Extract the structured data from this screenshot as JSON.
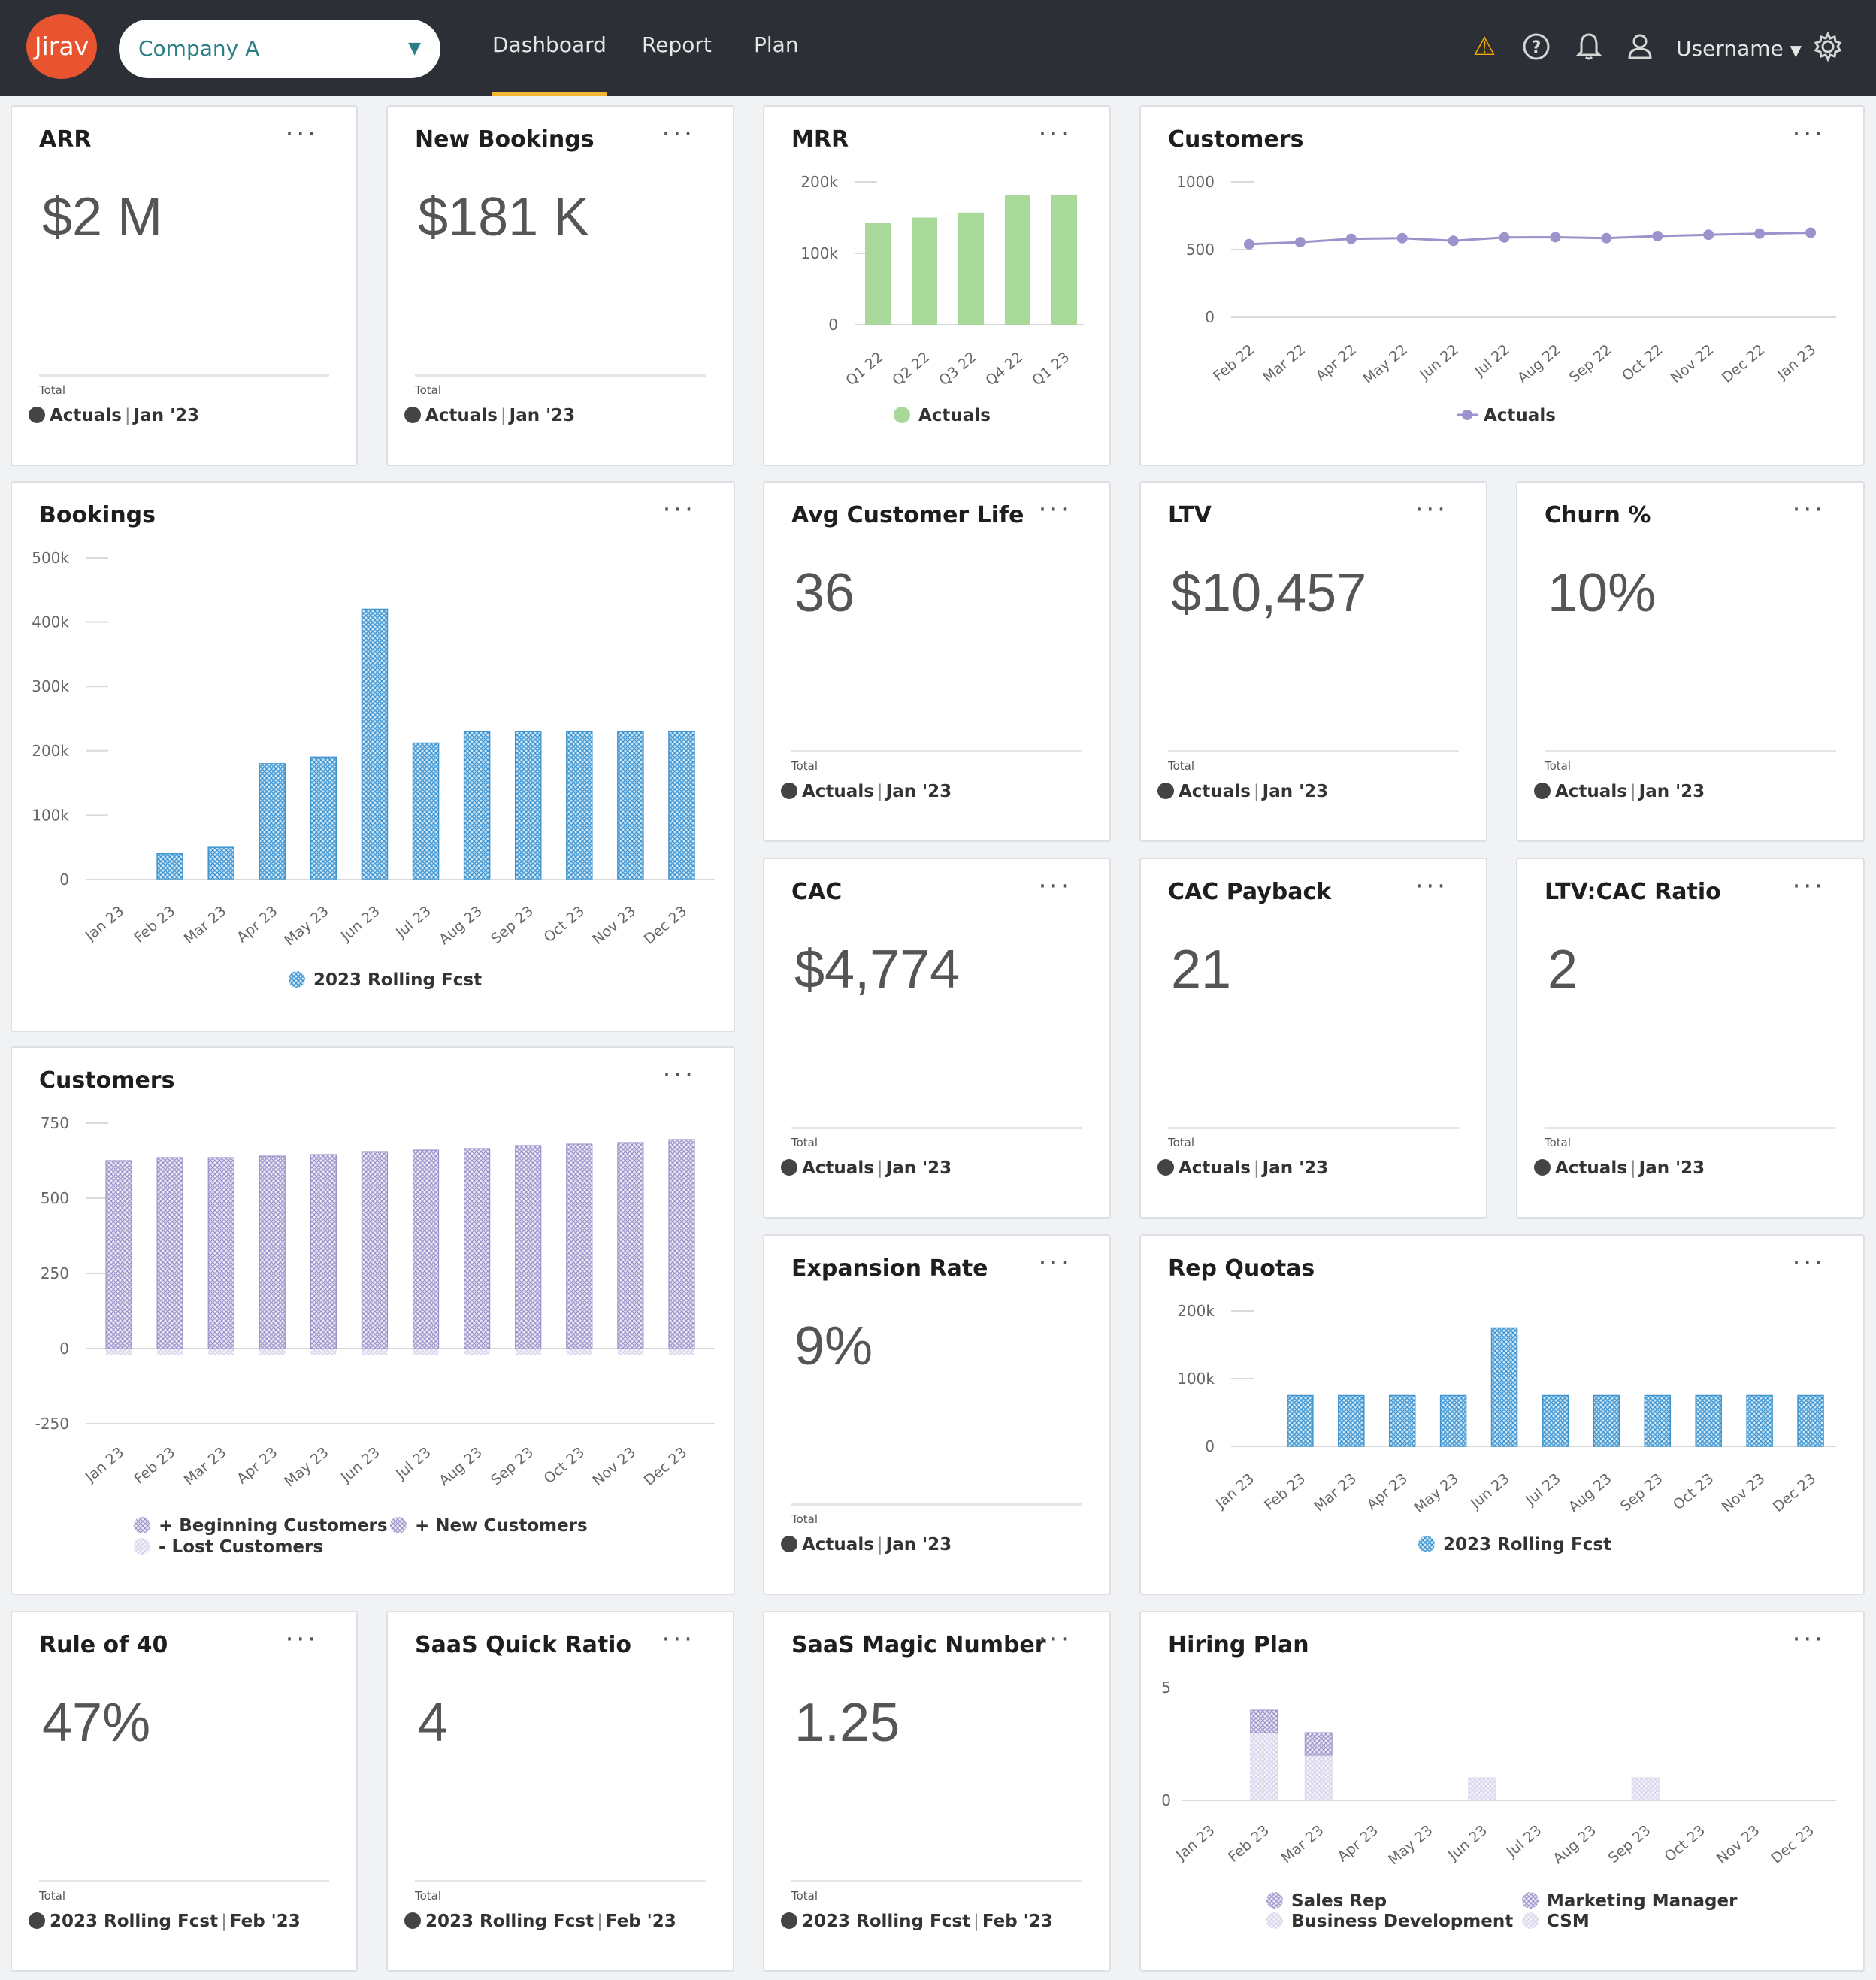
{
  "app": {
    "logo_text": "Jirav"
  },
  "topnav": {
    "company": "Company A",
    "links": [
      "Dashboard",
      "Report",
      "Plan"
    ],
    "icons": [
      "warning-icon",
      "help-icon",
      "bell-icon",
      "user-icon",
      "gear-icon"
    ],
    "username": "Username"
  },
  "cards": {
    "arr": {
      "title": "ARR",
      "value": "$2 M",
      "total": "Total",
      "series": "Actuals",
      "period": "Jan '23"
    },
    "new_bookings": {
      "title": "New Bookings",
      "value": "$181 K",
      "total": "Total",
      "series": "Actuals",
      "period": "Jan '23"
    },
    "avg_life": {
      "title": "Avg Customer Life",
      "value": "36",
      "total": "Total",
      "series": "Actuals",
      "period": "Jan '23"
    },
    "ltv": {
      "title": "LTV",
      "value": "$10,457",
      "total": "Total",
      "series": "Actuals",
      "period": "Jan '23"
    },
    "churn": {
      "title": "Churn %",
      "value": "10%",
      "total": "Total",
      "series": "Actuals",
      "period": "Jan '23"
    },
    "cac": {
      "title": "CAC",
      "value": "$4,774",
      "total": "Total",
      "series": "Actuals",
      "period": "Jan '23"
    },
    "cac_payback": {
      "title": "CAC Payback",
      "value": "21",
      "total": "Total",
      "series": "Actuals",
      "period": "Jan '23"
    },
    "ltv_cac": {
      "title": "LTV:CAC Ratio",
      "value": "2",
      "total": "Total",
      "series": "Actuals",
      "period": "Jan '23"
    },
    "expansion": {
      "title": "Expansion Rate",
      "value": "9%",
      "total": "Total",
      "series": "Actuals",
      "period": "Jan '23"
    },
    "rule40": {
      "title": "Rule of 40",
      "value": "47%",
      "total": "Total",
      "series": "2023 Rolling Fcst",
      "period": "Feb '23"
    },
    "quick_ratio": {
      "title": "SaaS Quick Ratio",
      "value": "4",
      "total": "Total",
      "series": "2023 Rolling Fcst",
      "period": "Feb '23"
    },
    "magic": {
      "title": "SaaS Magic Number",
      "value": "1.25",
      "total": "Total",
      "series": "2023 Rolling Fcst",
      "period": "Feb '23"
    },
    "mrr": {
      "title": "MRR"
    },
    "customers_line": {
      "title": "Customers"
    },
    "bookings": {
      "title": "Bookings"
    },
    "customers_bar": {
      "title": "Customers"
    },
    "rep_quotas": {
      "title": "Rep Quotas"
    },
    "hiring": {
      "title": "Hiring Plan"
    }
  },
  "colors": {
    "green": "#a8d99b",
    "blue": "#4a9ed6",
    "purple": "#a59ad0",
    "purple_light": "#e4e0f3",
    "accent": "#f2b632"
  },
  "chart_data": [
    {
      "id": "mrr",
      "type": "bar",
      "categories": [
        "Q1 22",
        "Q2 22",
        "Q3 22",
        "Q4 22",
        "Q1 23"
      ],
      "values": [
        143000,
        150000,
        157000,
        181000,
        182000
      ],
      "yticks": [
        "0",
        "100k",
        "200k"
      ],
      "ylim": [
        0,
        200000
      ],
      "legend": [
        "Actuals"
      ]
    },
    {
      "id": "customers_line",
      "type": "line",
      "categories": [
        "Feb 22",
        "Mar 22",
        "Apr 22",
        "May 22",
        "Jun 22",
        "Jul 22",
        "Aug 22",
        "Sep 22",
        "Oct 22",
        "Nov 22",
        "Dec 22",
        "Jan 23"
      ],
      "values": [
        540,
        555,
        580,
        585,
        565,
        590,
        592,
        585,
        600,
        610,
        618,
        625
      ],
      "yticks": [
        "0",
        "500",
        "1000"
      ],
      "ylim": [
        0,
        1000
      ],
      "legend": [
        "Actuals"
      ]
    },
    {
      "id": "bookings",
      "type": "bar",
      "categories": [
        "Jan 23",
        "Feb 23",
        "Mar 23",
        "Apr 23",
        "May 23",
        "Jun 23",
        "Jul 23",
        "Aug 23",
        "Sep 23",
        "Oct 23",
        "Nov 23",
        "Dec 23"
      ],
      "values": [
        0,
        40000,
        50000,
        180000,
        190000,
        420000,
        212000,
        230000,
        230000,
        230000,
        230000,
        230000
      ],
      "yticks": [
        "0",
        "100k",
        "200k",
        "300k",
        "400k",
        "500k"
      ],
      "ylim": [
        0,
        500000
      ],
      "legend": [
        "2023 Rolling Fcst"
      ]
    },
    {
      "id": "customers_bar",
      "type": "bar",
      "categories": [
        "Jan 23",
        "Feb 23",
        "Mar 23",
        "Apr 23",
        "May 23",
        "Jun 23",
        "Jul 23",
        "Aug 23",
        "Sep 23",
        "Oct 23",
        "Nov 23",
        "Dec 23"
      ],
      "series": [
        {
          "name": "+ Beginning Customers",
          "values": [
            625,
            635,
            635,
            640,
            645,
            655,
            660,
            665,
            675,
            680,
            685,
            695
          ]
        },
        {
          "name": "+ New Customers",
          "values": [
            0,
            0,
            0,
            0,
            0,
            0,
            0,
            0,
            0,
            0,
            0,
            0
          ]
        },
        {
          "name": "- Lost Customers",
          "values": [
            -20,
            -20,
            -20,
            -20,
            -20,
            -20,
            -20,
            -20,
            -20,
            -20,
            -20,
            -20
          ]
        }
      ],
      "yticks": [
        "-250",
        "0",
        "250",
        "500",
        "750"
      ],
      "ylim": [
        -250,
        750
      ]
    },
    {
      "id": "rep_quotas",
      "type": "bar",
      "categories": [
        "Jan 23",
        "Feb 23",
        "Mar 23",
        "Apr 23",
        "May 23",
        "Jun 23",
        "Jul 23",
        "Aug 23",
        "Sep 23",
        "Oct 23",
        "Nov 23",
        "Dec 23"
      ],
      "values": [
        0,
        75000,
        75000,
        75000,
        75000,
        175000,
        75000,
        75000,
        75000,
        75000,
        75000,
        75000
      ],
      "yticks": [
        "0",
        "100k",
        "200k"
      ],
      "ylim": [
        0,
        200000
      ],
      "legend": [
        "2023 Rolling Fcst"
      ]
    },
    {
      "id": "hiring",
      "type": "bar",
      "categories": [
        "Jan 23",
        "Feb 23",
        "Mar 23",
        "Apr 23",
        "May 23",
        "Jun 23",
        "Jul 23",
        "Aug 23",
        "Sep 23",
        "Oct 23",
        "Nov 23",
        "Dec 23"
      ],
      "series": [
        {
          "name": "Sales Rep",
          "values": [
            0,
            1,
            1,
            0,
            0,
            0,
            0,
            0,
            0,
            0,
            0,
            0
          ]
        },
        {
          "name": "Marketing Manager",
          "values": [
            0,
            0,
            0,
            0,
            0,
            0,
            0,
            0,
            0,
            0,
            0,
            0
          ]
        },
        {
          "name": "Business Development",
          "values": [
            0,
            3,
            2,
            0,
            0,
            1,
            0,
            0,
            1,
            0,
            0,
            0
          ]
        },
        {
          "name": "CSM",
          "values": [
            0,
            0,
            0,
            0,
            0,
            0,
            0,
            0,
            0,
            0,
            0,
            0
          ]
        }
      ],
      "yticks": [
        "0",
        "5"
      ],
      "ylim": [
        0,
        5
      ]
    }
  ]
}
